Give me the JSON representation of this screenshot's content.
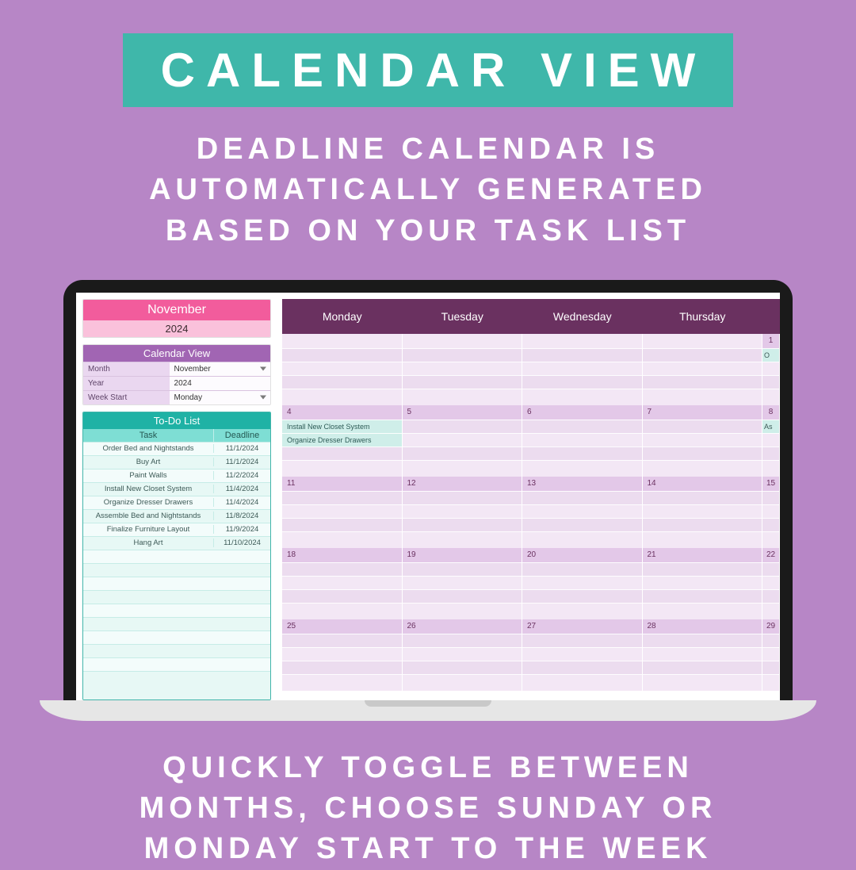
{
  "hero": {
    "badge": "CALENDAR VIEW",
    "para1_l1": "DEADLINE CALENDAR IS",
    "para1_l2": "AUTOMATICALLY GENERATED",
    "para1_l3": "BASED ON YOUR TASK LIST",
    "para2_l1": "QUICKLY TOGGLE BETWEEN",
    "para2_l2": "MONTHS, CHOOSE SUNDAY OR",
    "para2_l3": "MONDAY START TO THE WEEK"
  },
  "sidebar": {
    "month": "November",
    "year": "2024",
    "settings_header": "Calendar View",
    "settings": {
      "month_label": "Month",
      "month_value": "November",
      "year_label": "Year",
      "year_value": "2024",
      "week_label": "Week Start",
      "week_value": "Monday"
    },
    "todo_header": "To-Do List",
    "todo_col1": "Task",
    "todo_col2": "Deadline",
    "tasks": [
      {
        "task": "Order Bed and Nightstands",
        "deadline": "11/1/2024"
      },
      {
        "task": "Buy Art",
        "deadline": "11/1/2024"
      },
      {
        "task": "Paint Walls",
        "deadline": "11/2/2024"
      },
      {
        "task": "Install New Closet System",
        "deadline": "11/4/2024"
      },
      {
        "task": "Organize Dresser Drawers",
        "deadline": "11/4/2024"
      },
      {
        "task": "Assemble Bed and Nightstands",
        "deadline": "11/8/2024"
      },
      {
        "task": "Finalize Furniture Layout",
        "deadline": "11/9/2024"
      },
      {
        "task": "Hang Art",
        "deadline": "11/10/2024"
      }
    ]
  },
  "calendar": {
    "days": [
      "Monday",
      "Tuesday",
      "Wednesday",
      "Thursday"
    ],
    "friday_partial_num": "1",
    "friday_partial_o": "O",
    "weeks": [
      {
        "nums": [
          "",
          "",
          "",
          ""
        ],
        "fri": "1"
      },
      {
        "nums": [
          "4",
          "5",
          "6",
          "7"
        ],
        "fri": "8",
        "mon_tasks": [
          "Install New Closet System",
          "Organize Dresser Drawers"
        ],
        "fri_task": "As"
      },
      {
        "nums": [
          "11",
          "12",
          "13",
          "14"
        ],
        "fri": "15"
      },
      {
        "nums": [
          "18",
          "19",
          "20",
          "21"
        ],
        "fri": "22"
      },
      {
        "nums": [
          "25",
          "26",
          "27",
          "28"
        ],
        "fri": "29"
      }
    ]
  }
}
